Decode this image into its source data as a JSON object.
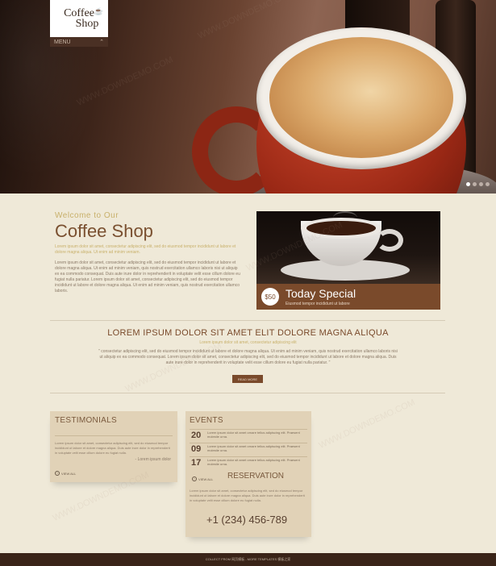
{
  "brand": {
    "line1": "Coffee",
    "line2": "Shop",
    "icon": "coffee-mug-icon"
  },
  "menu": {
    "label": "MENU",
    "toggle_icon": "chevron-up-icon"
  },
  "slider": {
    "dots": 4,
    "active": 1
  },
  "welcome": {
    "kicker": "Welcome to Our",
    "title": "Coffee Shop",
    "intro": "Lorem ipsum dolor sit amet, consectetur adipiscing elit, sed do eiusmod tempor incididunt ut labore et dolore magna aliqua. Ut enim ad minim veniam.",
    "body": "Lorem ipsum dolor sit amet, consectetur adipiscing elit, sed do eiusmod tempor incididunt ut labore et dolore magna aliqua. Ut enim ad minim veniam, quis nostrud exercitation ullamco laboris nisi ut aliquip ex ea commodo consequat. Duis aute irure dolor in reprehenderit in voluptate velit esse cillum dolore eu fugiat nulla pariatur. Lorem ipsum dolor sit amet, consectetur adipiscing elit, sed do eiusmod tempor incididunt ut labore et dolore magna aliqua. Ut enim ad minim veniam, quis nostrud exercitation ullamco laboris."
  },
  "special": {
    "price": "$50",
    "title": "Today Special",
    "subtitle": "Eiusmod tempor incididunt ut labore"
  },
  "lorem": {
    "title": "LOREM IPSUM DOLOR SIT AMET ELIT DOLORE MAGNA ALIQUA",
    "subtitle": "Lorem ipsum dolor sit amet, consectetur adipiscing elit",
    "body": "\" consectetur adipiscing elit, sed do eiusmod tempor incididunt ut labore et dolore magna aliqua. Ut enim ad minim veniam, quis nostrud exercitation ullamco laboris nisi ut aliquip ex ea commodo consequat. Lorem ipsum dolor sit amet, consectetur adipiscing elit, sed do eiusmod tempor incididunt ut labore et dolore magna aliqua. Duis aute irure dolor in reprehenderit in voluptate velit esse cillum dolore eu fugiat nulla pariatur. \"",
    "button": "READ MORE"
  },
  "testimonials": {
    "title": "TESTIMONIALS",
    "body": "Lorem ipsum dolor sit amet, consectetur adipiscing elit, sed do eiusmod tempor incididunt ut labore et dolore magna aliqua. Duis aute irure dolor in reprehenderit in voluptate velit esse cillum dolore eu fugiat nulla.",
    "author": "- Lorem ipsum dolor",
    "view_all": "VIEW ALL"
  },
  "events": {
    "title": "EVENTS",
    "items": [
      {
        "day": "20",
        "text": "Lorem ipsum dolor sit amet ornare tellus adipiscing elit. Praesent molestie urna."
      },
      {
        "day": "09",
        "text": "Lorem ipsum dolor sit amet ornare tellus adipiscing elit. Praesent molestie urna."
      },
      {
        "day": "17",
        "text": "Lorem ipsum dolor sit amet ornare tellus adipiscing elit. Praesent molestie urna."
      }
    ],
    "view_all": "VIEW ALL"
  },
  "reservation": {
    "title": "RESERVATION",
    "body": "Lorem ipsum dolor sit amet, consectetur adipiscing elit, sed do eiusmod tempor incididunt ut labore et dolore magna aliqua. Duis aute irure dolor in reprehenderit in voluptate velit esse cillum dolore eu fugiat nulla.",
    "phone": "+1 (234) 456-789"
  },
  "footer": {
    "text": "COLLECT FROM 网页模板 - MORE TEMPLATES 模板之家"
  },
  "watermark": "WWW.DOWNDEMO.COM"
}
